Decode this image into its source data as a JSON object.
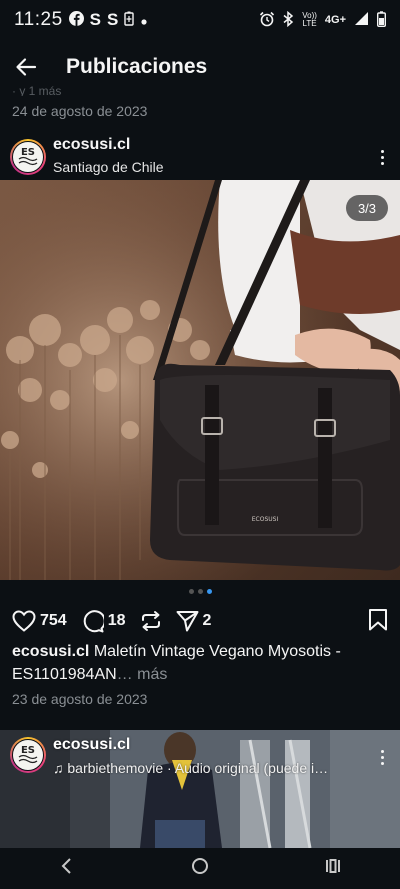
{
  "status_bar": {
    "time": "11:25",
    "left_icons": [
      "facebook-icon",
      "s-app-icon",
      "s-app-icon",
      "battery-saver-icon",
      "dot-icon"
    ],
    "right_icons": [
      "alarm-icon",
      "bluetooth-icon",
      "volte-icon",
      "signal-icon",
      "battery-icon"
    ],
    "volte_text_1": "Vo))",
    "volte_text_2": "LTE",
    "network": "4G+",
    "s1": "S",
    "s2": "S"
  },
  "header": {
    "title": "Publicaciones"
  },
  "previous_post": {
    "snippet": "· y 1 más",
    "date": "24 de agosto de 2023"
  },
  "post": {
    "username": "ecosusi.cl",
    "location": "Santiago de Chile",
    "counter": "3/3",
    "bag_brand": "ECOSUSI",
    "likes": "754",
    "comments": "18",
    "shares": "2",
    "caption_user": "ecosusi.cl",
    "caption_text": " Maletín Vintage Vegano Myosotis - ES1101984AN",
    "caption_more": "… más",
    "date": "23 de agosto de 2023",
    "carousel_total": 3,
    "carousel_index": 3
  },
  "next_post": {
    "username": "ecosusi.cl",
    "audio": "barbiethemovie · Audio original (puede i…"
  },
  "colors": {
    "background": "#0c1014",
    "accent": "#3897f0",
    "muted_text": "#8a8f94"
  }
}
